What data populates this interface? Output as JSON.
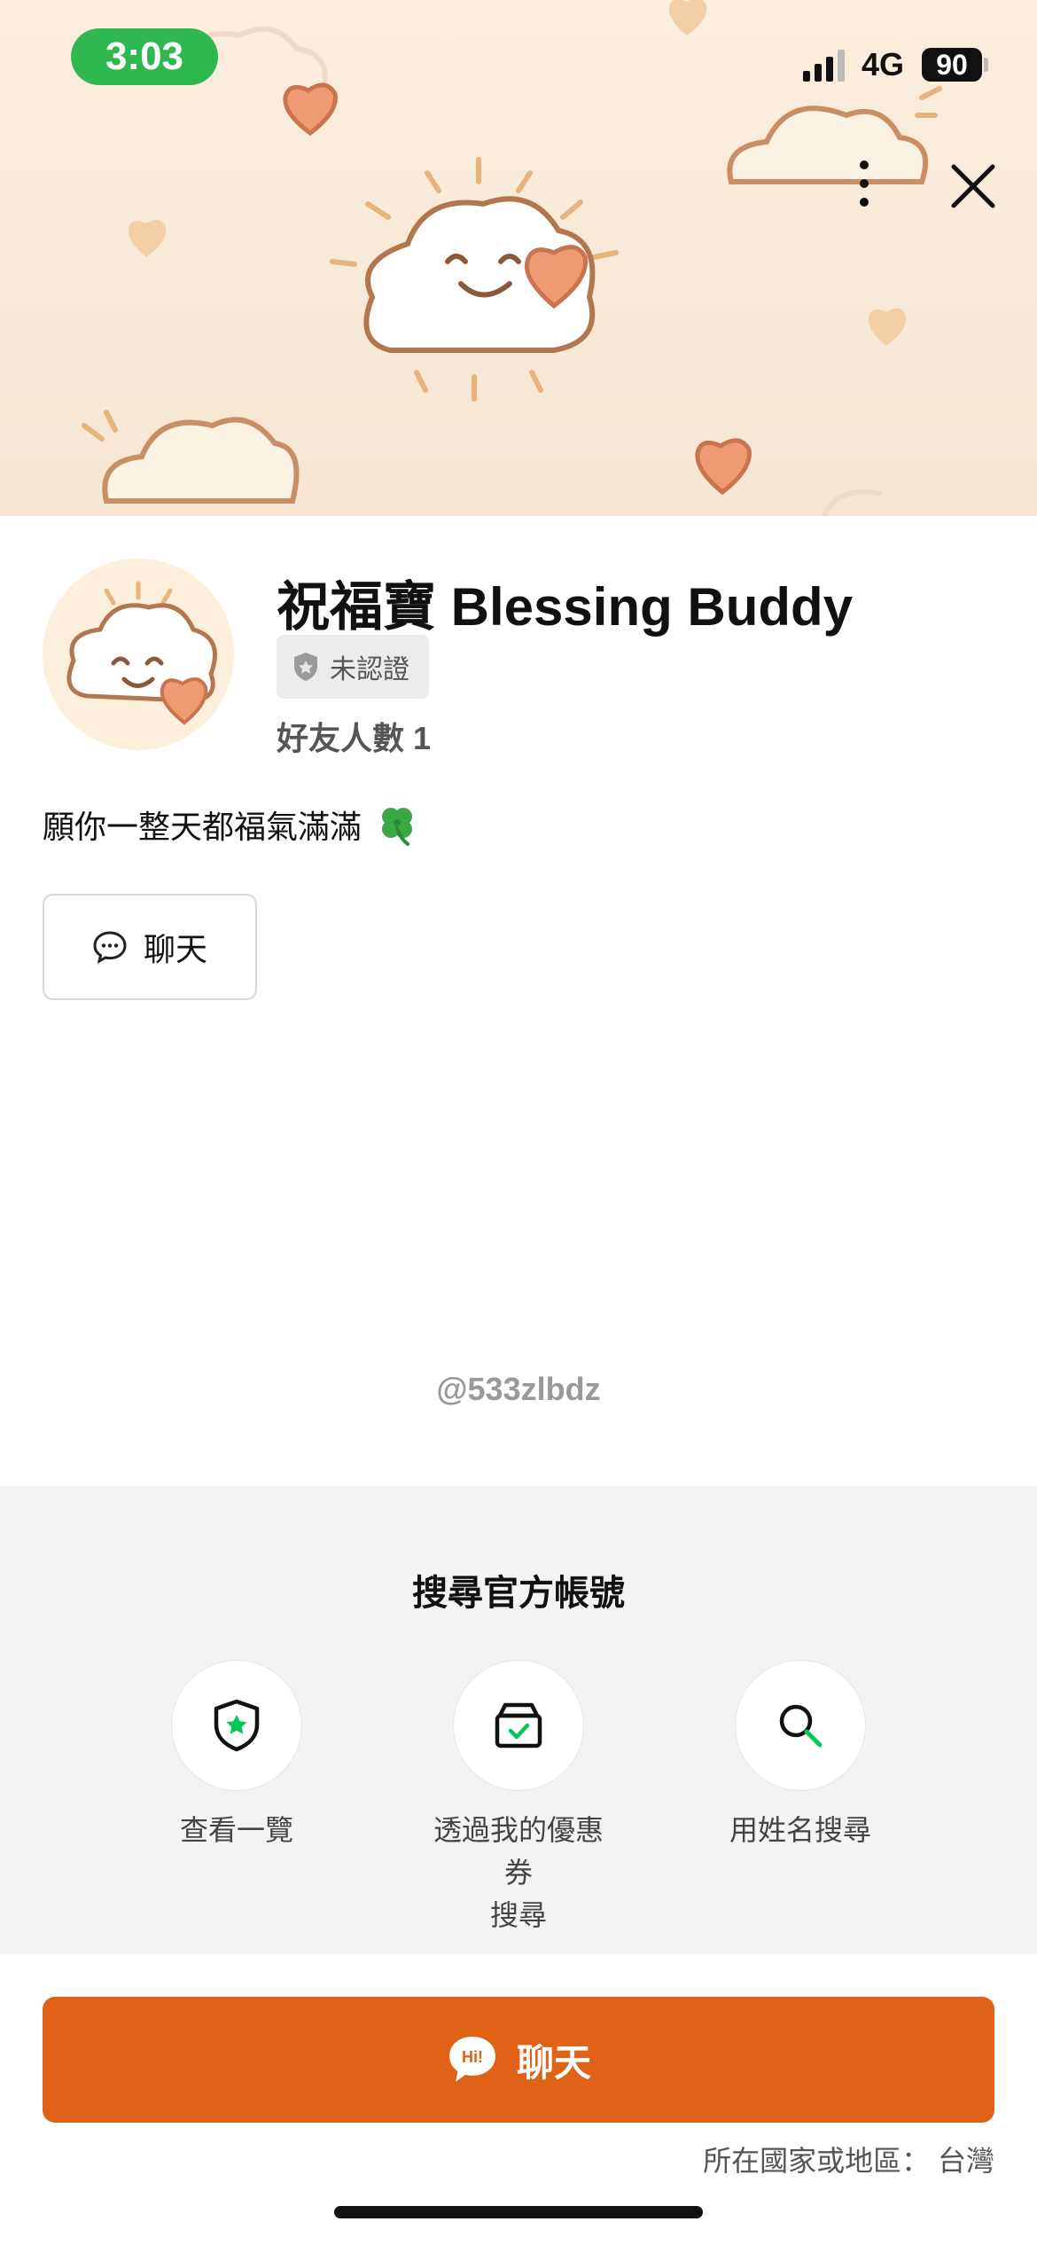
{
  "status_bar": {
    "time": "3:03",
    "network": "4G",
    "battery": "90"
  },
  "header": {
    "more_icon": "vertical-ellipsis-icon",
    "close_icon": "close-icon"
  },
  "profile": {
    "name": "祝福寶 Blessing Buddy",
    "verification_label": "未認證",
    "friends": "好友人數 1",
    "status_message": "願你一整天都福氣滿滿",
    "status_emoji": "clover-icon",
    "account_id": "@533zlbdz"
  },
  "actions": {
    "chat_small_label": "聊天",
    "chat_main_label": "聊天"
  },
  "search": {
    "heading": "搜尋官方帳號",
    "items": [
      {
        "label": "查看一覽",
        "icon": "shield-star-icon"
      },
      {
        "label": "透過我的優惠\n券\n搜尋",
        "icon": "coupon-box-icon"
      },
      {
        "label": "用姓名搜尋",
        "icon": "search-icon"
      }
    ]
  },
  "footer": {
    "region": "所在國家或地區： 台灣"
  },
  "colors": {
    "accent": "#df6217",
    "status_green": "#2fb84f",
    "line_green": "#06c755",
    "cover_bg": "#f6e6d2"
  }
}
